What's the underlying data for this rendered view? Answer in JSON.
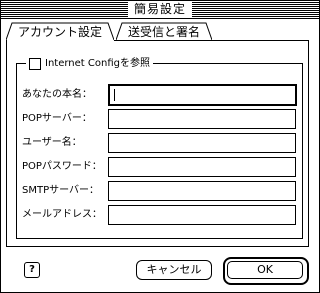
{
  "window": {
    "title": "簡易設定"
  },
  "tabs": [
    {
      "label": "アカウント設定",
      "active": true
    },
    {
      "label": "送受信と署名",
      "active": false
    }
  ],
  "group": {
    "checkbox_label": "Internet Configを参照",
    "checked": false
  },
  "fields": [
    {
      "label": "あなたの本名：",
      "value": ""
    },
    {
      "label": "POPサーバー：",
      "value": ""
    },
    {
      "label": "ユーザー名：",
      "value": ""
    },
    {
      "label": "POPパスワード：",
      "value": ""
    },
    {
      "label": "SMTPサーバー：",
      "value": ""
    },
    {
      "label": "メールアドレス：",
      "value": ""
    }
  ],
  "buttons": {
    "help": "?",
    "cancel": "キャンセル",
    "ok": "OK"
  }
}
